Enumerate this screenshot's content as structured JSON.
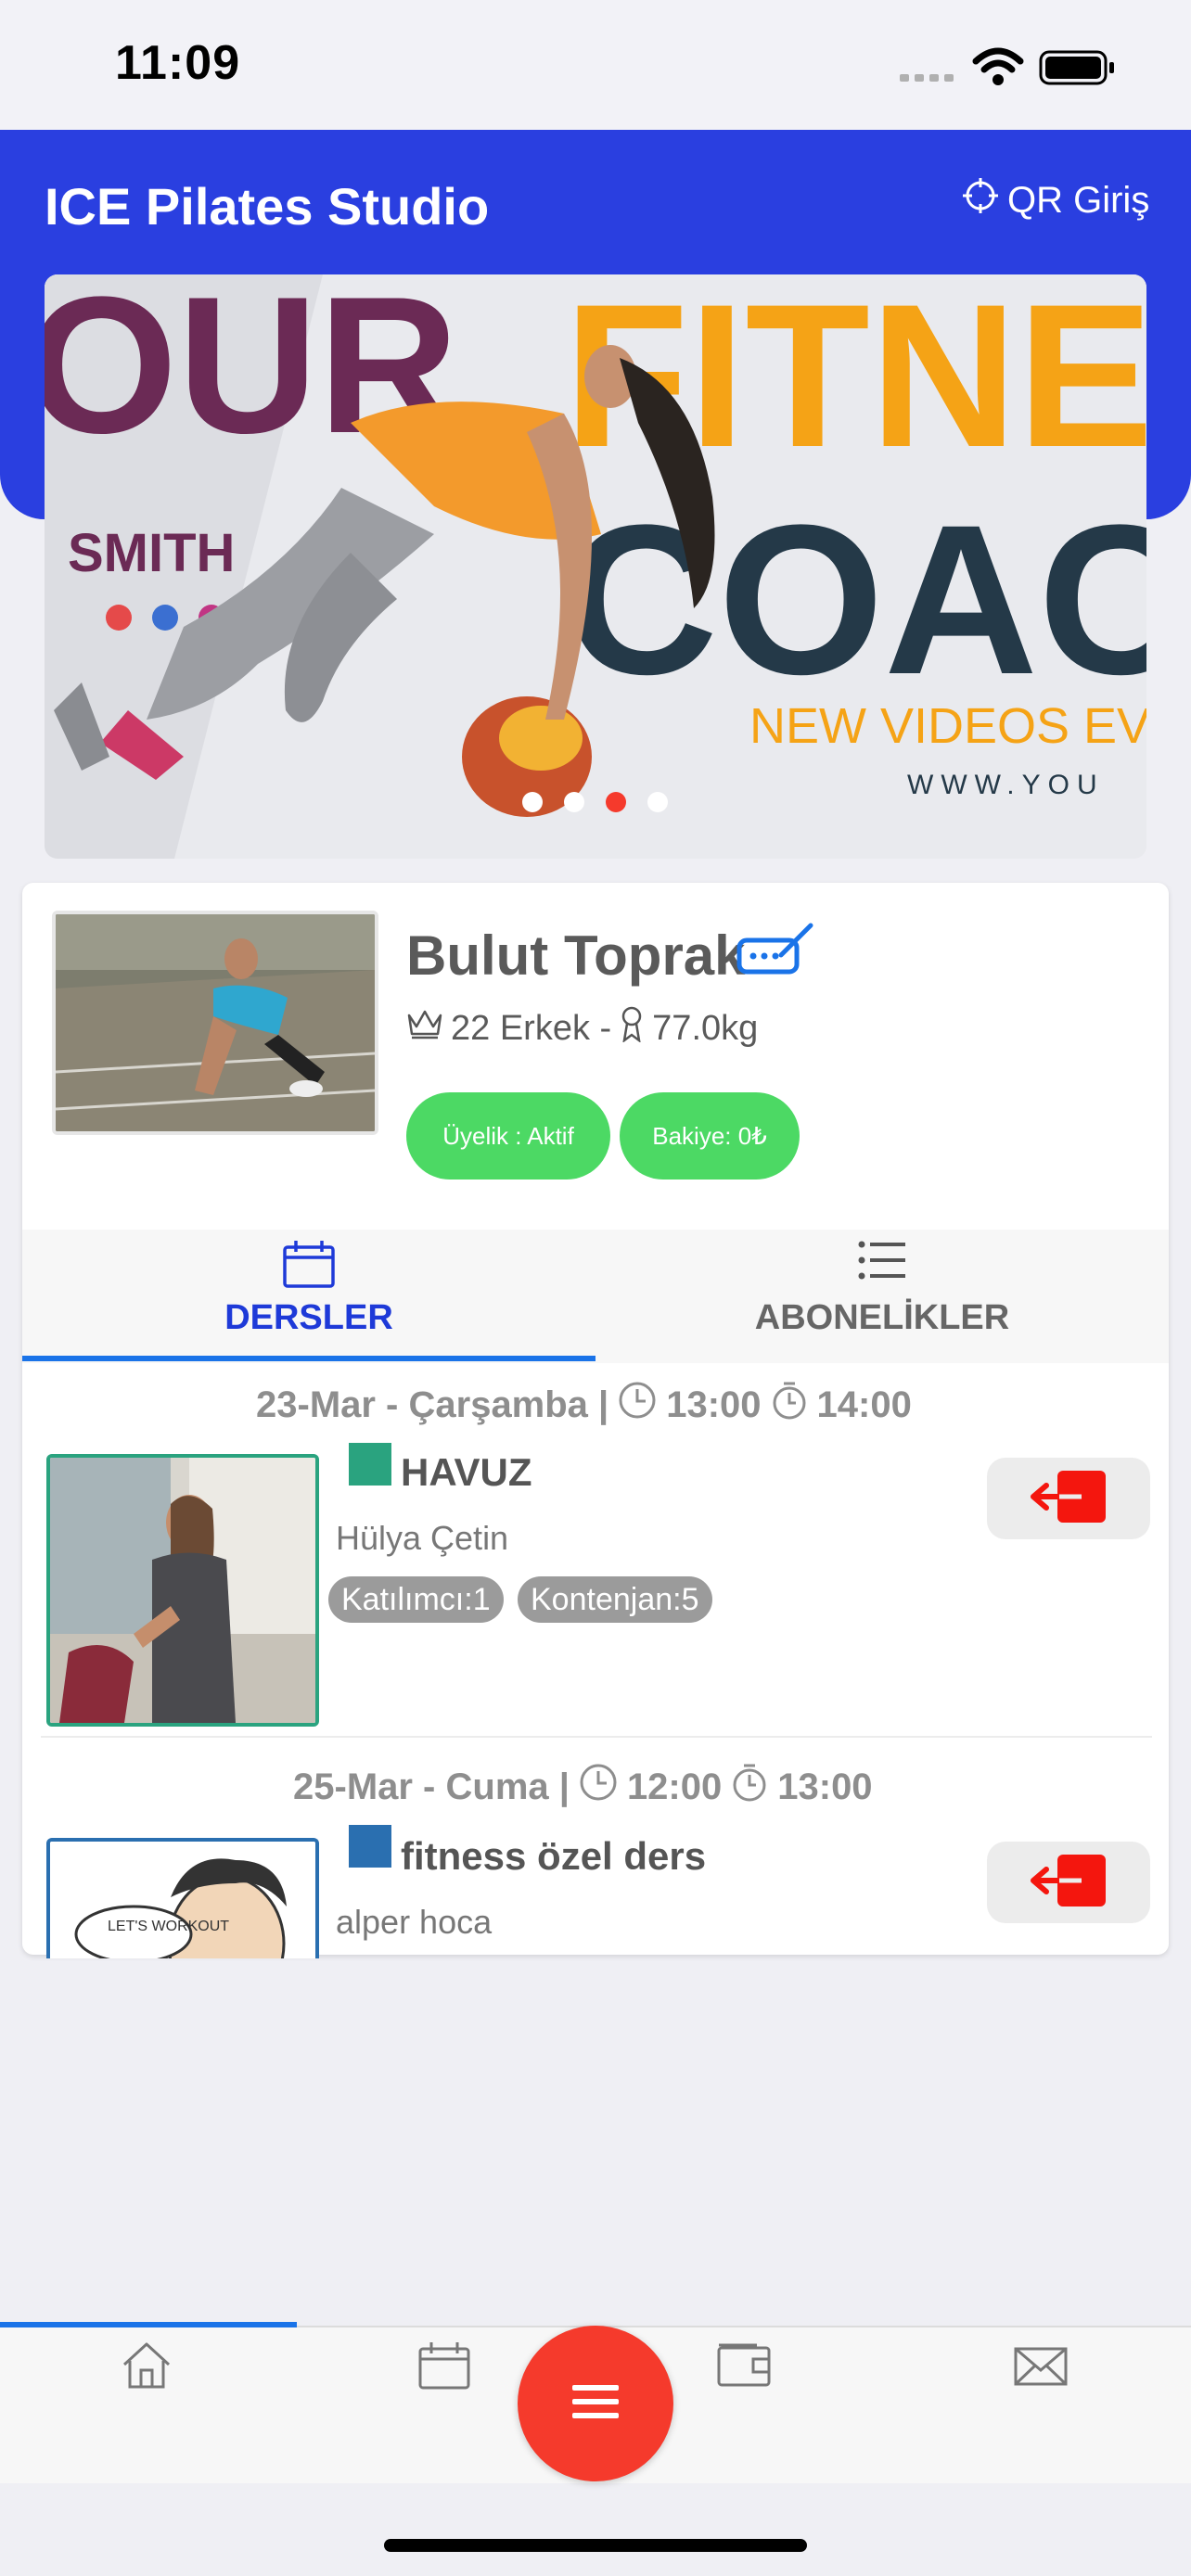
{
  "status_bar": {
    "time": "11:09"
  },
  "header": {
    "title": "ICE Pilates Studio",
    "qr_label": "QR Giriş"
  },
  "banner": {
    "text_line1": "OUR",
    "text_line2": "FITNE",
    "text_line3": "COAC",
    "name": "SMITH",
    "subtitle": "NEW VIDEOS EV",
    "url": "WWW.YOU",
    "dot_count": 4,
    "active_dot": 3
  },
  "profile": {
    "name": "Bulut Toprak",
    "age_gender": "22 Erkek -",
    "weight": "77.0kg",
    "membership_badge": "Üyelik : Aktif",
    "balance_badge": "Bakiye: 0₺"
  },
  "tabs": [
    {
      "label": "DERSLER",
      "active": true
    },
    {
      "label": "ABONELİKLER",
      "active": false
    }
  ],
  "lessons": [
    {
      "date": "23-Mar - Çarşamba |",
      "start": "13:00",
      "end": "14:00",
      "title": "HAVUZ",
      "color": "#2aa37f",
      "instructor": "Hülya Çetin",
      "participants": "Katılımcı:1",
      "capacity": "Kontenjan:5"
    },
    {
      "date": "25-Mar - Cuma |",
      "start": "12:00",
      "end": "13:00",
      "title": "fitness özel ders",
      "color": "#2a6fb0",
      "instructor": "alper hoca",
      "image_caption": "LET'S WORKOUT"
    }
  ],
  "bottom_nav": [
    "home-icon",
    "calendar-icon",
    "menu-icon",
    "wallet-icon",
    "mail-icon"
  ],
  "colors": {
    "header_blue": "#2a3fe0",
    "accent_blue": "#1a73e8",
    "badge_green": "#4cd964",
    "fab_red": "#f53a2c"
  }
}
